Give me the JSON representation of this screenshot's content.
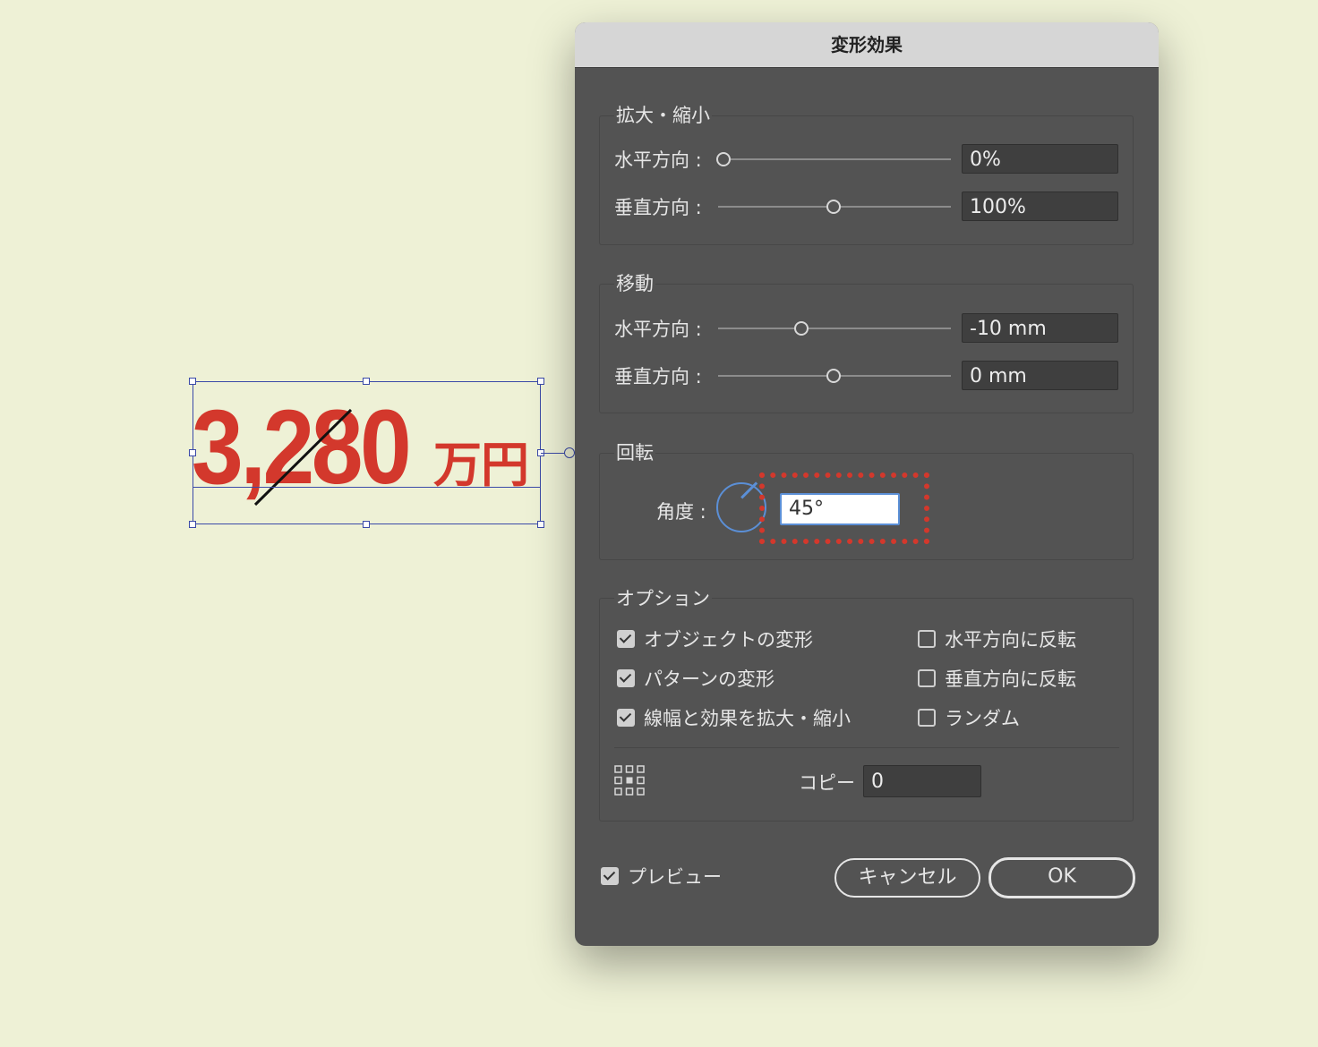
{
  "artwork": {
    "price_number": "3,280",
    "price_unit": "万円",
    "text_color": "#d3382c",
    "selection_color": "#3b4aa8"
  },
  "dialog": {
    "title": "変形効果",
    "scale": {
      "title": "拡大・縮小",
      "horizontal_label": "水平方向 :",
      "horizontal_value": "0%",
      "vertical_label": "垂直方向 :",
      "vertical_value": "100%"
    },
    "move": {
      "title": "移動",
      "horizontal_label": "水平方向 :",
      "horizontal_value": "-10 mm",
      "vertical_label": "垂直方向 :",
      "vertical_value": "0 mm"
    },
    "rotate": {
      "title": "回転",
      "angle_label": "角度 :",
      "angle_value": "45°",
      "dial_icon": "angle-dial-icon"
    },
    "options": {
      "title": "オプション",
      "transform_objects": {
        "label": "オブジェクトの変形",
        "checked": true
      },
      "transform_patterns": {
        "label": "パターンの変形",
        "checked": true
      },
      "scale_strokes": {
        "label": "線幅と効果を拡大・縮小",
        "checked": true
      },
      "reflect_x": {
        "label": "水平方向に反転",
        "checked": false
      },
      "reflect_y": {
        "label": "垂直方向に反転",
        "checked": false
      },
      "random": {
        "label": "ランダム",
        "checked": false
      },
      "reference_point_icon": "reference-point-icon",
      "copies_label": "コピー",
      "copies_value": "0"
    },
    "preview": {
      "label": "プレビュー",
      "checked": true
    },
    "cancel_label": "キャンセル",
    "ok_label": "OK",
    "highlight_color": "#d3382c",
    "accent_color": "#5b8fd6"
  }
}
